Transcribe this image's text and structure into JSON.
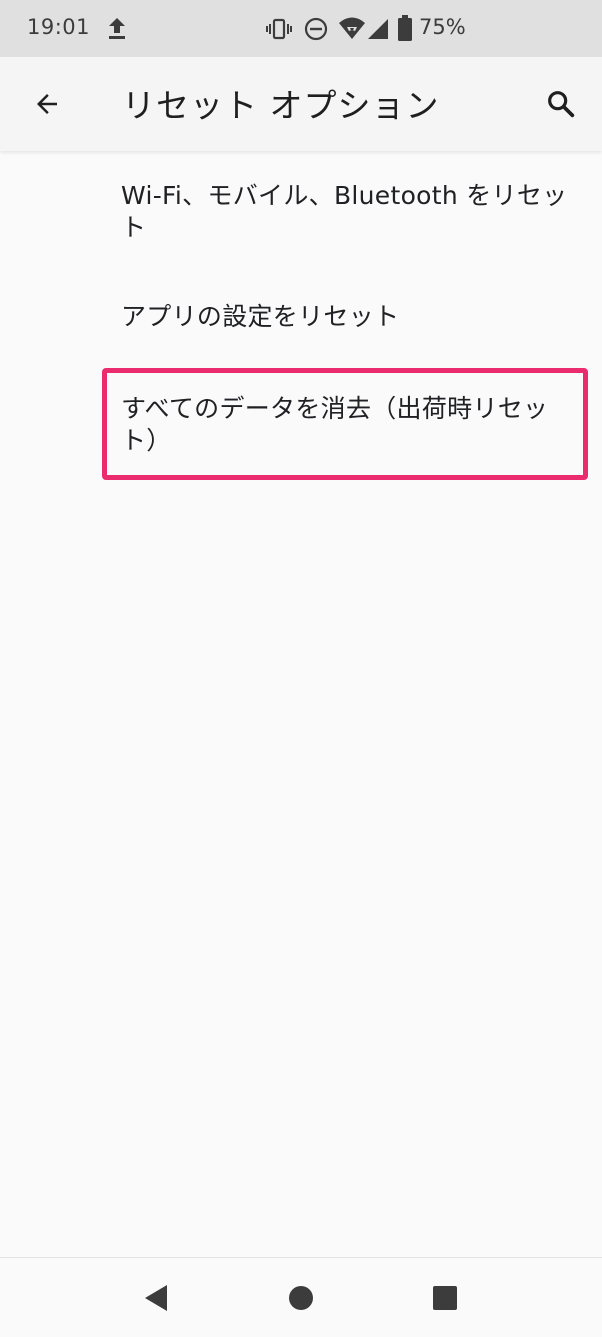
{
  "status_bar": {
    "time": "19:01",
    "battery_percent": "75%",
    "icons": [
      "upload-icon",
      "vibrate-icon",
      "do-not-disturb-icon",
      "wifi-icon",
      "cell-signal-icon",
      "battery-icon"
    ]
  },
  "app_bar": {
    "title": "リセット オプション",
    "back_icon": "arrow-back-icon",
    "search_icon": "search-icon"
  },
  "options": [
    {
      "label": "Wi-Fi、モバイル、Bluetooth をリセット"
    },
    {
      "label": "アプリの設定をリセット"
    },
    {
      "label": "すべてのデータを消去（出荷時リセット）"
    }
  ],
  "highlight_color": "#ea2c6e",
  "nav_bar": {
    "icons": [
      "nav-back-icon",
      "nav-home-icon",
      "nav-recents-icon"
    ]
  }
}
